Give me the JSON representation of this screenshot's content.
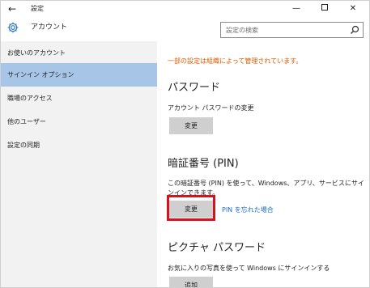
{
  "titlebar": {
    "back_glyph": "←",
    "title": "設定",
    "minimize_glyph": "—",
    "close_glyph": "✕"
  },
  "header": {
    "title": "アカウント",
    "search_placeholder": "設定の検索"
  },
  "sidebar": {
    "items": [
      {
        "label": "お使いのアカウント"
      },
      {
        "label": "サインイン オプション",
        "selected": true
      },
      {
        "label": "職場のアクセス"
      },
      {
        "label": "他のユーザー"
      },
      {
        "label": "設定の同期"
      }
    ]
  },
  "main": {
    "managed_notice": "一部の設定は組織によって管理されています。",
    "password": {
      "heading": "パスワード",
      "description": "アカウント パスワードの変更",
      "button": "変更"
    },
    "pin": {
      "heading": "暗証番号 (PIN)",
      "description": "この暗証番号 (PIN) を使って、Windows、アプリ、サービスにサインインできます。",
      "button": "変更",
      "forgot_link": "PIN を忘れた場合"
    },
    "picture_password": {
      "heading": "ピクチャ パスワード",
      "description": "お気に入りの写真を使って Windows にサインインする",
      "button": "追加"
    }
  },
  "colors": {
    "accent": "#2b78c5",
    "selected_bg": "#a7c6e7",
    "warning": "#e05a00",
    "link": "#1d6fc7",
    "highlight_box": "#d6131c"
  }
}
